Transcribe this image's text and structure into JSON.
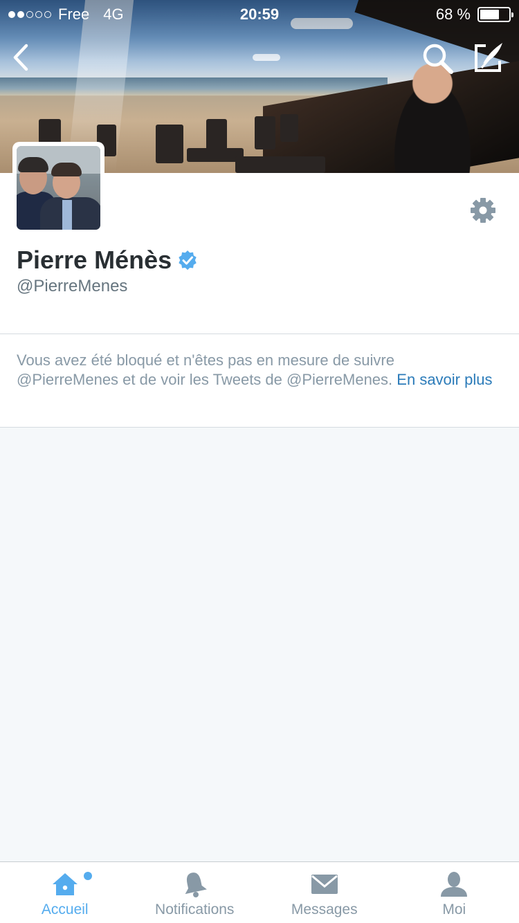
{
  "status_bar": {
    "signal_dots_filled": 2,
    "signal_dots_total": 5,
    "carrier": "Free",
    "network": "4G",
    "time": "20:59",
    "battery_text": "68 %",
    "battery_level": 0.68
  },
  "nav": {
    "back_icon": "chevron-left-icon",
    "search_icon": "search-icon",
    "compose_icon": "compose-icon"
  },
  "profile": {
    "name": "Pierre Ménès",
    "handle": "@PierreMenes",
    "verified": true,
    "settings_icon": "gear-icon"
  },
  "blocked": {
    "message": "Vous avez été bloqué et n'êtes pas en mesure de suivre @PierreMenes et de voir les Tweets de @PierreMenes.",
    "link": "En savoir plus"
  },
  "tabbar": {
    "tabs": [
      {
        "label": "Accueil",
        "icon": "home-icon",
        "active": true,
        "has_dot": true
      },
      {
        "label": "Notifications",
        "icon": "bell-icon",
        "active": false
      },
      {
        "label": "Messages",
        "icon": "envelope-icon",
        "active": false
      },
      {
        "label": "Moi",
        "icon": "person-icon",
        "active": false
      }
    ]
  },
  "colors": {
    "accent": "#55acee",
    "link": "#2b7bb9",
    "muted_text": "#8899a6",
    "background": "#f5f8fa"
  }
}
